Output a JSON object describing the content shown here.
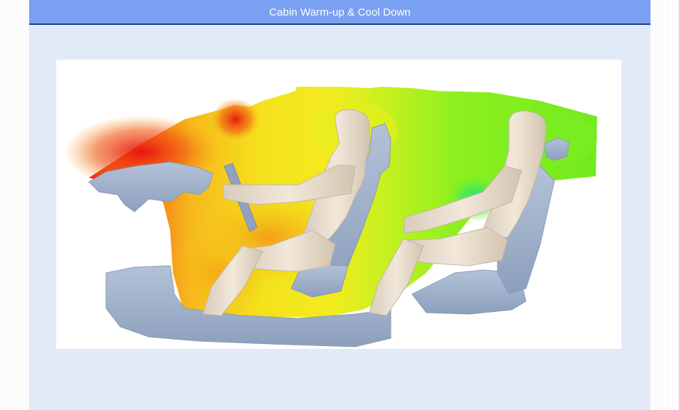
{
  "header": {
    "title": "Cabin Warm-up & Cool Down"
  },
  "figure": {
    "subject": "car-cabin-thermal-simulation",
    "colors": {
      "hot": "#ee1a10",
      "warm": "#f7a416",
      "mild": "#f3ea1c",
      "cool": "#8cf01e",
      "cold": "#3ee86a",
      "body": "#9fb1cc",
      "mannequin": "#ede2d2"
    }
  },
  "colors": {
    "page_background": "#e2e9f7",
    "title_bar": "#7aa1f1",
    "title_rule": "#1b3d86"
  }
}
